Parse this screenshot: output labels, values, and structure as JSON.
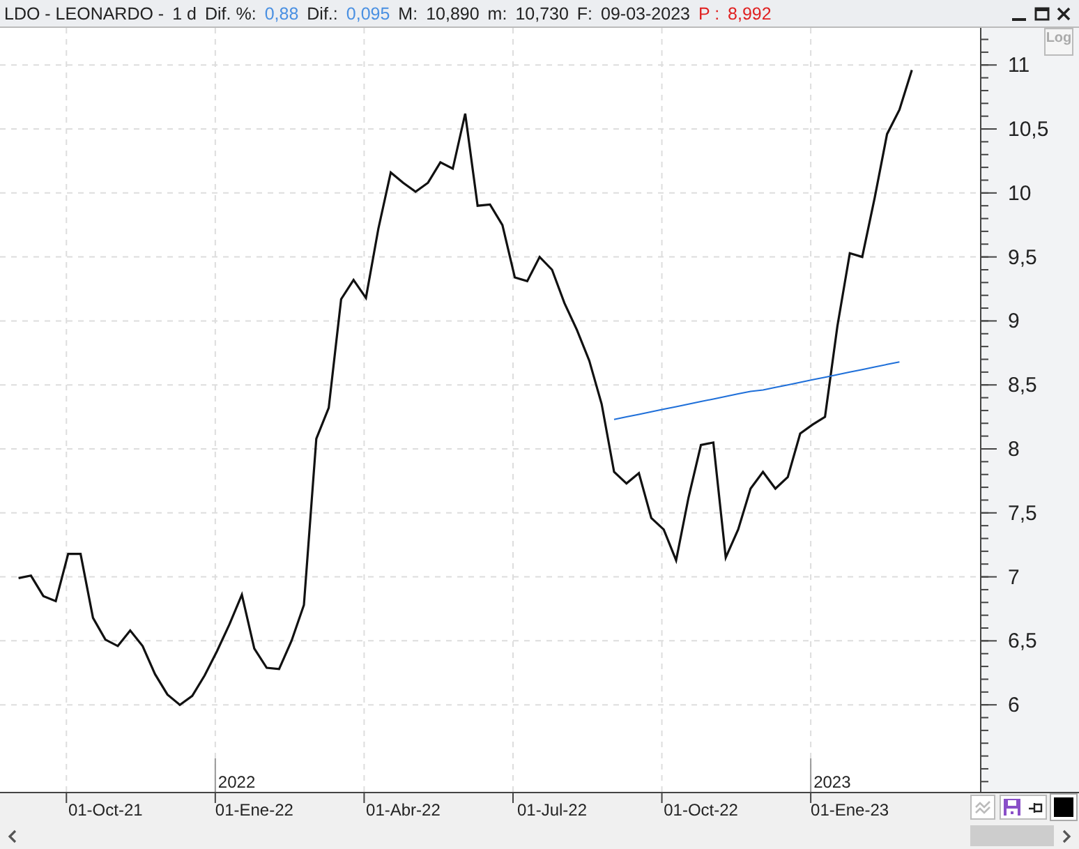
{
  "header": {
    "symbol": "LDO - LEONARDO -",
    "period": "1 d",
    "fields": [
      {
        "label": "Dif. %:",
        "value": "0,88",
        "kind": "change"
      },
      {
        "label": "Dif.:",
        "value": "0,095",
        "kind": "change"
      },
      {
        "label": "M:",
        "value": "10,890",
        "kind": "plain"
      },
      {
        "label": "m:",
        "value": "10,730",
        "kind": "plain"
      },
      {
        "label": "F:",
        "value": "09-03-2023",
        "kind": "plain"
      },
      {
        "label": "P :",
        "value": "8,992",
        "kind": "price"
      }
    ]
  },
  "log_button": {
    "label": "Log",
    "selected": false
  },
  "chart": {
    "chart_data": {
      "type": "line",
      "grid": true,
      "ylim": [
        5.32,
        11.29
      ],
      "yticks": [
        {
          "value": 6,
          "label": "6"
        },
        {
          "value": 6.5,
          "label": "6,5"
        },
        {
          "value": 7,
          "label": "7"
        },
        {
          "value": 7.5,
          "label": "7,5"
        },
        {
          "value": 8,
          "label": "8"
        },
        {
          "value": 8.5,
          "label": "8,5"
        },
        {
          "value": 9,
          "label": "9"
        },
        {
          "value": 9.5,
          "label": "9,5"
        },
        {
          "value": 10,
          "label": "10"
        },
        {
          "value": 10.5,
          "label": "10,5"
        },
        {
          "value": 11,
          "label": "11"
        }
      ],
      "categories": [
        null,
        null,
        null,
        null,
        null,
        null,
        null,
        null,
        "01-Oct-21",
        null,
        null,
        null,
        null,
        null,
        null,
        null,
        null,
        null,
        null,
        null,
        "01-Ene-22",
        null,
        null,
        null,
        null,
        null,
        null,
        null,
        null,
        null,
        null,
        null,
        "01-Abr-22",
        null,
        null,
        null,
        null,
        null,
        null,
        null,
        null,
        null,
        null,
        null,
        "01-Jul-22",
        null,
        null,
        null,
        null,
        null,
        null,
        null,
        null,
        null,
        null,
        null,
        "01-Oct-22",
        null,
        null,
        null,
        null,
        null,
        null,
        null,
        null,
        null,
        null,
        null,
        "01-Ene-23",
        null,
        null,
        null,
        null,
        null,
        null,
        null,
        null,
        null,
        null
      ],
      "series": [
        {
          "color": "#111111",
          "values": [
            null,
            6.99,
            7.01,
            6.85,
            6.81,
            7.18,
            7.18,
            6.68,
            6.51,
            6.46,
            6.58,
            6.46,
            6.24,
            6.08,
            6.0,
            6.07,
            6.23,
            6.42,
            6.63,
            6.86,
            6.44,
            6.29,
            6.28,
            6.5,
            6.78,
            8.08,
            8.32,
            9.17,
            9.32,
            9.18,
            9.72,
            10.16,
            10.08,
            10.01,
            10.08,
            10.24,
            10.19,
            10.62,
            9.9,
            9.91,
            9.75,
            9.34,
            9.31,
            9.5,
            9.4,
            9.14,
            8.93,
            8.69,
            8.35,
            7.82,
            7.73,
            7.81,
            7.46,
            7.37,
            7.13,
            7.62,
            8.03,
            8.05,
            7.15,
            7.37,
            7.69,
            7.82,
            7.69,
            7.78,
            8.12,
            8.19,
            8.25,
            8.96,
            9.53,
            9.5,
            9.96,
            10.46,
            10.65,
            10.96,
            null,
            null,
            null,
            null,
            null
          ]
        },
        {
          "color": "#1e6fd9",
          "values": [
            null,
            null,
            null,
            null,
            null,
            null,
            null,
            null,
            null,
            null,
            null,
            null,
            null,
            null,
            null,
            null,
            null,
            null,
            null,
            null,
            null,
            null,
            null,
            null,
            null,
            null,
            null,
            null,
            null,
            null,
            null,
            null,
            null,
            null,
            null,
            null,
            null,
            null,
            null,
            null,
            null,
            null,
            null,
            null,
            null,
            null,
            null,
            null,
            null,
            8.23,
            8.25,
            8.27,
            8.29,
            8.31,
            8.33,
            8.35,
            8.37,
            8.39,
            8.41,
            8.43,
            8.45,
            8.46,
            8.48,
            8.5,
            8.52,
            8.54,
            8.56,
            8.58,
            8.6,
            8.62,
            8.64,
            8.66,
            8.68,
            null,
            null,
            null,
            null,
            null,
            null
          ]
        }
      ]
    },
    "year_labels": [
      "2022",
      "2023"
    ]
  }
}
